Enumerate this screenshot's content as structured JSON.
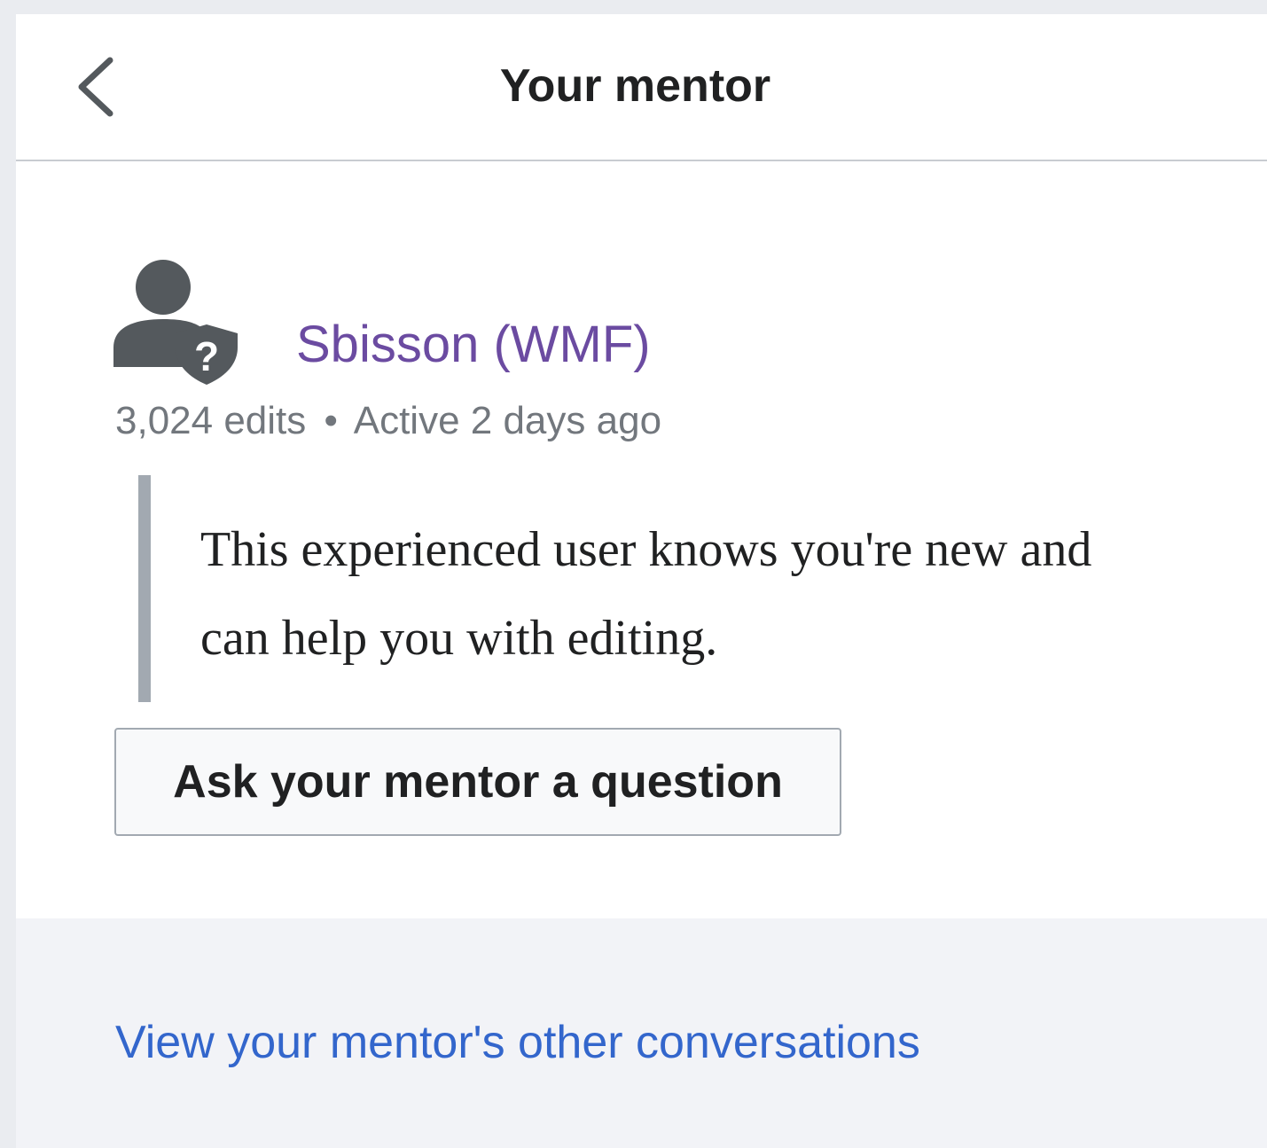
{
  "header": {
    "title": "Your mentor",
    "back_icon": "chevron-left-icon"
  },
  "mentor": {
    "icon": "user-question-icon",
    "name": "Sbisson (WMF)",
    "name_color": "#6b4ba1",
    "edits": "3,024 edits",
    "separator": "•",
    "activity": "Active 2 days ago",
    "description": "This experienced user knows you're new and can help you with editing."
  },
  "actions": {
    "ask_button_label": "Ask your mentor a question"
  },
  "footer": {
    "link_text": "View your mentor's other conversations",
    "link_color": "#3366cc"
  }
}
